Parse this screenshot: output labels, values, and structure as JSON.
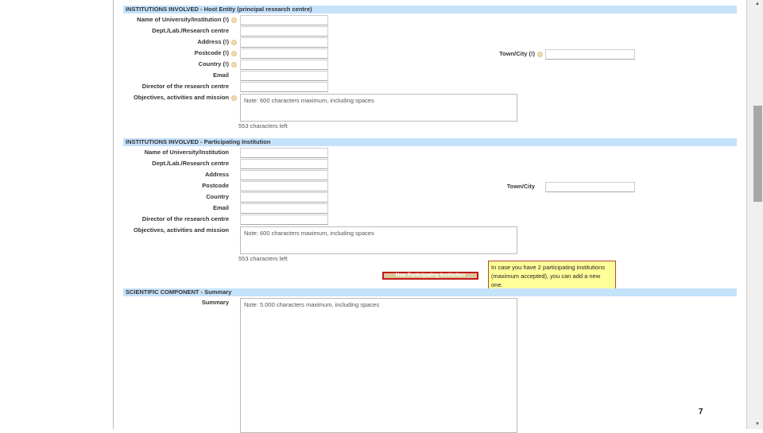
{
  "sections": [
    {
      "header": "INSTITUTIONS INVOLVED - Host Entity (principal research centre)",
      "fields": [
        {
          "label": "Name of University/Institution (!)",
          "help": true,
          "value": ""
        },
        {
          "label": "Dept./Lab./Research centre",
          "help": false,
          "value": ""
        },
        {
          "label": "Address (!)",
          "help": true,
          "value": ""
        },
        {
          "label": "Postcode (!)",
          "help": true,
          "value": ""
        },
        {
          "label": "Country (!)",
          "help": true,
          "value": ""
        },
        {
          "label": "Email",
          "help": false,
          "value": ""
        },
        {
          "label": "Director of the research centre",
          "help": false,
          "value": ""
        }
      ],
      "town_label": "Town/City (!)",
      "town_help": true,
      "textarea_label": "Objectives, activities and mission",
      "textarea_placeholder": "Note: 600 characters maximum, including spaces",
      "chars_left": "553 characters left"
    },
    {
      "header": "INSTITUTIONS INVOLVED - Participating Institution",
      "fields": [
        {
          "label": "Name of University/Institution",
          "help": false,
          "value": ""
        },
        {
          "label": "Dept./Lab./Research centre",
          "help": false,
          "value": ""
        },
        {
          "label": "Address",
          "help": false,
          "value": ""
        },
        {
          "label": "Postcode",
          "help": false,
          "value": ""
        },
        {
          "label": "Country",
          "help": false,
          "value": ""
        },
        {
          "label": "Email",
          "help": false,
          "value": ""
        },
        {
          "label": "Director of the research centre",
          "help": false,
          "value": ""
        }
      ],
      "town_label": "Town/City",
      "town_help": false,
      "textarea_label": "Objectives, activities and mission",
      "textarea_placeholder": "Note: 600 characters maximum, including spaces",
      "chars_left": "553 characters left"
    }
  ],
  "new_institution_button": "New Participating Institution",
  "tooltip": "In case you have 2 participating institutions (maximum accepted), you can add a new one.",
  "summary": {
    "header": "SCIENTIFIC COMPONENT - Summary",
    "label": "Summary",
    "placeholder": "Note: 5.000 characters maximum, including spaces"
  },
  "page_number": "7"
}
